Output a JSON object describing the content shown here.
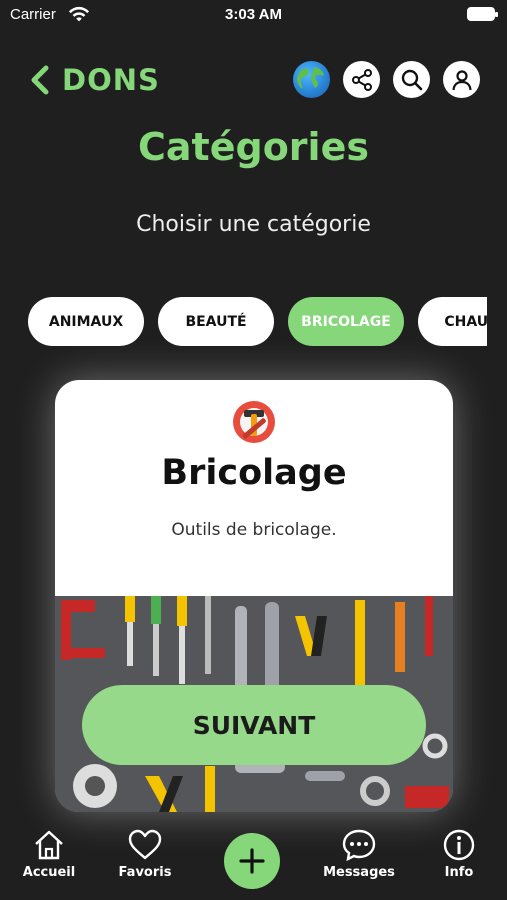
{
  "status_bar": {
    "carrier": "Carrier",
    "time": "3:03 AM"
  },
  "header": {
    "back_label": "DONS"
  },
  "title": "Catégories",
  "subtitle": "Choisir une catégorie",
  "categories": [
    {
      "label": "ANIMAUX",
      "active": false
    },
    {
      "label": "BEAUTÉ",
      "active": false
    },
    {
      "label": "BRICOLAGE",
      "active": true
    },
    {
      "label": "CHAUSS",
      "active": false
    }
  ],
  "card": {
    "title": "Bricolage",
    "description": "Outils de bricolage.",
    "icon": "tools-icon"
  },
  "next_button": "SUIVANT",
  "bottom_nav": [
    {
      "label": "Accueil",
      "icon": "home-icon"
    },
    {
      "label": "Favoris",
      "icon": "heart-icon"
    },
    {
      "label": "",
      "icon": "plus-icon"
    },
    {
      "label": "Messages",
      "icon": "chat-icon"
    },
    {
      "label": "Info",
      "icon": "info-icon"
    }
  ],
  "colors": {
    "accent": "#86d77a",
    "background": "#1f1f1f"
  }
}
